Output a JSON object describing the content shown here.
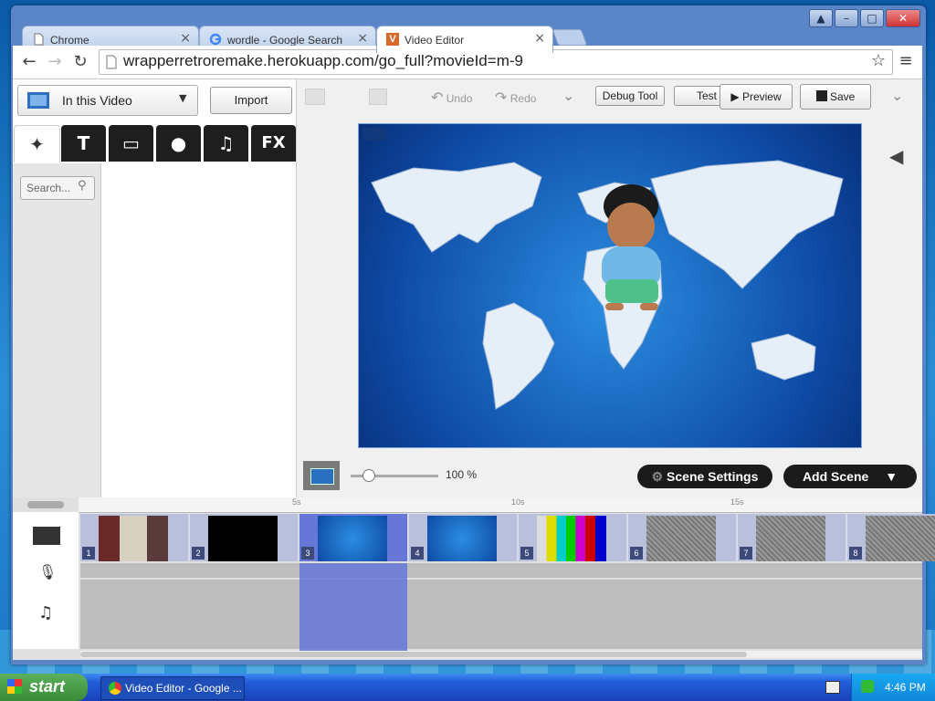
{
  "browser": {
    "tabs": [
      {
        "label": "Chrome",
        "close": "×"
      },
      {
        "label": "wordle - Google Search",
        "close": "×"
      },
      {
        "label": "Video Editor",
        "close": "×",
        "favicon_letter": "V"
      }
    ],
    "url": "wrapperretroremake.herokuapp.com/go_full?movieId=m-9",
    "window_controls": [
      "▲",
      "–",
      "□",
      "✕"
    ]
  },
  "library": {
    "dropdown_label": "In this Video",
    "import_label": "Import",
    "fx_label": "FX",
    "search_placeholder": "Search..."
  },
  "toolbar": {
    "undo": "Undo",
    "redo": "Redo",
    "debug": "Debug Tool",
    "test": "Test",
    "preview": "Preview",
    "save": "Save"
  },
  "stage_controls": {
    "zoom": "100 %",
    "zoom_fraction": 0.2,
    "scene_settings": "Scene Settings",
    "add_scene": "Add Scene"
  },
  "timeline": {
    "ruler": [
      "5s",
      "10s",
      "15s"
    ],
    "scenes": [
      {
        "num": "1",
        "thumb": "office"
      },
      {
        "num": "2",
        "thumb": "black"
      },
      {
        "num": "3",
        "thumb": "map-character",
        "selected": true
      },
      {
        "num": "4",
        "thumb": "map"
      },
      {
        "num": "5",
        "thumb": "color-bars"
      },
      {
        "num": "6",
        "thumb": "static"
      },
      {
        "num": "7",
        "thumb": "static"
      },
      {
        "num": "8",
        "thumb": "static"
      }
    ]
  },
  "taskbar": {
    "start": "start",
    "task": "Video Editor - Google ...",
    "clock": "4:46 PM"
  }
}
